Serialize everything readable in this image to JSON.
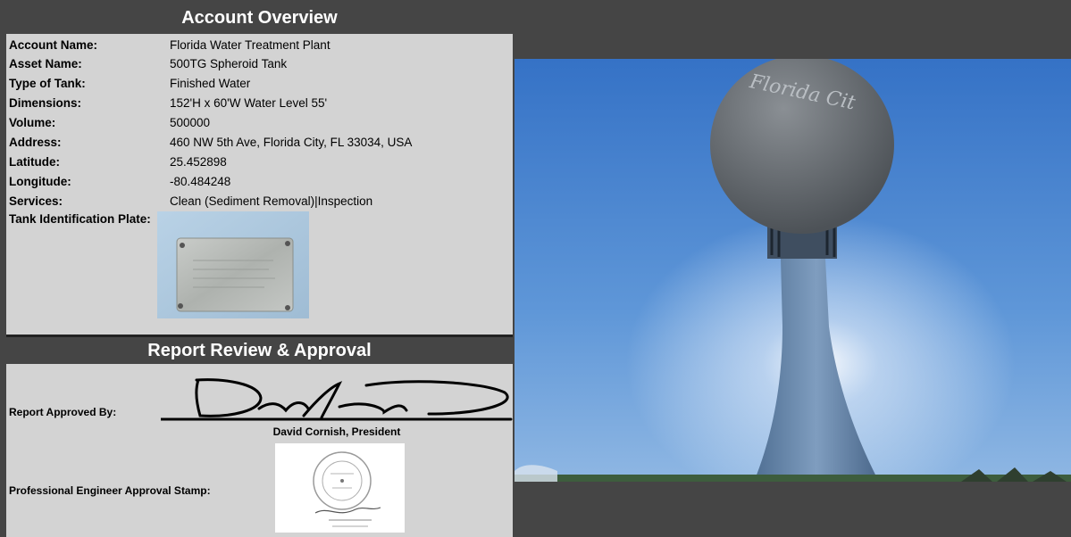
{
  "account_overview": {
    "title": "Account Overview",
    "rows": [
      {
        "label": "Account Name:",
        "value": "Florida Water Treatment Plant"
      },
      {
        "label": "Asset Name:",
        "value": "500TG Spheroid Tank"
      },
      {
        "label": "Type of Tank:",
        "value": "Finished Water"
      },
      {
        "label": "Dimensions:",
        "value": "152'H x 60'W  Water Level 55'"
      },
      {
        "label": "Volume:",
        "value": "500000"
      },
      {
        "label": "Address:",
        "value": "460 NW 5th Ave, Florida City, FL 33034, USA"
      },
      {
        "label": "Latitude:",
        "value": "25.452898"
      },
      {
        "label": "Longitude:",
        "value": "-80.484248"
      },
      {
        "label": "Services:",
        "value": "Clean (Sediment Removal)|Inspection"
      }
    ],
    "plate_label": "Tank Identification Plate:"
  },
  "report_approval": {
    "title": "Report Review & Approval",
    "approved_by_label": "Report Approved By:",
    "approver_name": "David Cornish, President",
    "stamp_label": "Professional Engineer Approval Stamp:"
  },
  "photo": {
    "tank_lettering": "Florida Cit"
  },
  "colors": {
    "header_bg": "#454545",
    "panel_bg": "#d3d3d3",
    "sky": "#3f7fd0"
  }
}
